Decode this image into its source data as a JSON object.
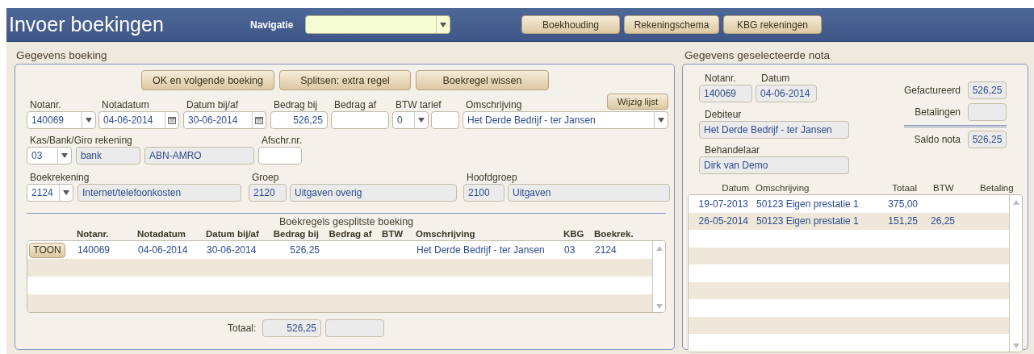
{
  "header": {
    "title": "Invoer boekingen",
    "navigation_label": "Navigatie",
    "buttons": [
      "Boekhouding",
      "Rekeningschema",
      "KBG rekeningen"
    ]
  },
  "booking": {
    "title": "Gegevens boeking",
    "actions": [
      "OK en volgende boeking",
      "Splitsen: extra regel",
      "Boekregel wissen"
    ],
    "edit_list_button": "Wijzig lijst",
    "entry_fields": [
      {
        "label": "Notanr.",
        "kind": "select",
        "value": "140069"
      },
      {
        "label": "Notadatum",
        "kind": "date",
        "value": "04-06-2014"
      },
      {
        "label": "Datum bij/af",
        "kind": "date",
        "value": "30-06-2014"
      },
      {
        "label": "Bedrag bij",
        "kind": "amount",
        "value": "526,25"
      },
      {
        "label": "Bedrag af",
        "kind": "amount"
      },
      {
        "label": "BTW tarief",
        "kind": "select",
        "value": "0"
      },
      {
        "kind": "input"
      },
      {
        "label": "Omschrijving",
        "kind": "select",
        "value": "Het Derde Bedrijf - ter Jansen"
      }
    ],
    "cash_account_fields": [
      {
        "label": "Kas/Bank/Giro rekening",
        "kind": "select",
        "value": "03"
      },
      {
        "kind": "readonly",
        "value": "bank"
      },
      {
        "kind": "readonly",
        "value": "ABN-AMRO"
      },
      {
        "label": "Afschr.nr.",
        "kind": "input"
      }
    ],
    "ledger_fields": [
      {
        "label": "Boekrekening",
        "kind": "select",
        "value": "2124"
      },
      {
        "kind": "readonly",
        "value": "Internet/telefoonkosten"
      },
      {
        "label": "Groep",
        "kind": "readonly",
        "value": "2120"
      },
      {
        "kind": "readonly",
        "value": "Uitgaven overig"
      },
      {
        "label": "Hoofdgroep",
        "kind": "readonly",
        "value": "2100"
      },
      {
        "kind": "readonly",
        "value": "Uitgaven"
      }
    ],
    "lines": {
      "title": "Boekregels gesplitste boeking",
      "columns": [
        "Notanr.",
        "Notadatum",
        "Datum bij/af",
        "Bedrag bij",
        "Bedrag af",
        "BTW",
        "Omschrijving",
        "KBG",
        "Boekrek."
      ],
      "rows": [
        {
          "button": "TOON",
          "cells": [
            "140069",
            "04-06-2014",
            "30-06-2014",
            "526,25",
            null,
            null,
            "Het Derde Bedrijf - ter Jansen",
            "03",
            "2124"
          ]
        }
      ],
      "total_label": "Totaal:",
      "total_bij": "526,25"
    }
  },
  "selected_invoice": {
    "title": "Gegevens geselecteerde nota",
    "notanr_label": "Notanr.",
    "notanr": "140069",
    "datum_label": "Datum",
    "datum": "04-06-2014",
    "debiteur_label": "Debiteur",
    "debiteur": "Het Derde Bedrijf - ter Jansen",
    "behandelaar_label": "Behandelaar",
    "behandelaar": "Dirk van Demo",
    "totals": [
      {
        "label": "Gefactureerd",
        "value": "526,25"
      },
      {
        "label": "Betalingen"
      },
      {
        "label": "Saldo nota",
        "value": "526,25"
      }
    ],
    "history": {
      "columns": [
        "Datum",
        "Omschrijving",
        "Totaal",
        "BTW",
        "Betaling"
      ],
      "rows": [
        [
          "19-07-2013",
          "50123 Eigen prestatie 1",
          "375,00",
          null,
          null
        ],
        [
          "26-05-2014",
          "50123 Eigen prestatie 1",
          "151,25",
          "26,25",
          null
        ]
      ]
    }
  }
}
